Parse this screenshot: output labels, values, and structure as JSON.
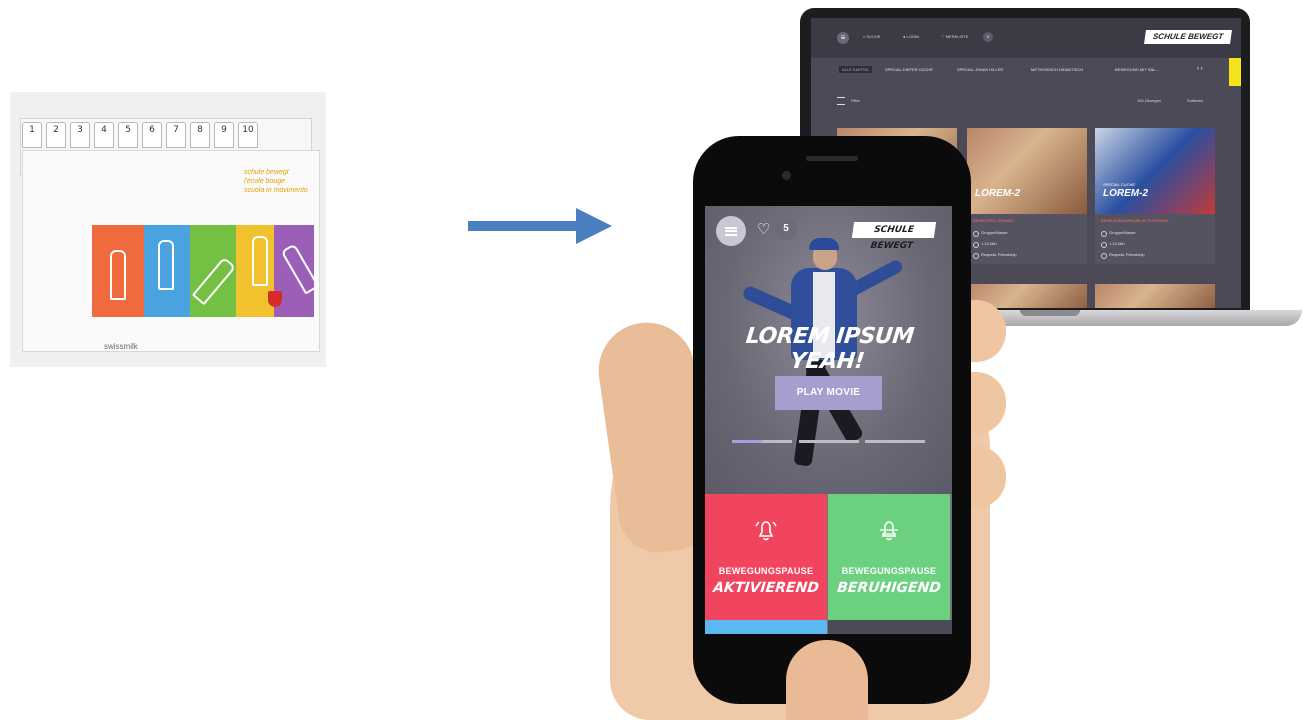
{
  "left_box": {
    "tab_numbers": [
      "1",
      "2",
      "3",
      "4",
      "5",
      "6",
      "7",
      "8",
      "9",
      "10"
    ],
    "side_text": [
      "schule bewegt",
      "l'école bouge",
      "scuola in movimento"
    ],
    "brand": "swissmilk",
    "stripe_colors": [
      "#ef6a3c",
      "#4aa3df",
      "#74c043",
      "#f2c12e",
      "#9b5fb8"
    ]
  },
  "arrow": {
    "color": "#4a7ebf"
  },
  "laptop": {
    "nav": {
      "search_label": "SUCHE",
      "login_label": "LOGIN",
      "watchlist_label": "MERKLISTE",
      "watchlist_count": "0",
      "logo": "SCHULE BEWEGT"
    },
    "tabs": [
      "ALLE KAPITEL",
      "SPECIAL DIEFER CUCHE",
      "SPECIAL JONAS HILLER",
      "METHODISCH DIDAKTISCH",
      "BEWEGUNG MIT SAL..."
    ],
    "filter_label": "Filter",
    "results_label": "100 Übungen",
    "sort_label": "Sortieren",
    "cards": [
      {
        "subtitle": "",
        "title": "LOREM-2",
        "tag": "BEWEGTES LERNEN",
        "lines": [
          "Gruppe/Klasse",
          "1-10 Min",
          "Respekt, Friendship"
        ]
      },
      {
        "subtitle": "SPECIAL CUCHE",
        "title": "LOREM-2",
        "tag": "BEWEGUNGSPAUSE AKTIVIEREND",
        "lines": [
          "Gruppe/Klasse",
          "1-10 Min",
          "Respekt, Friendship"
        ]
      }
    ]
  },
  "phone": {
    "fav_count": "5",
    "logo": "SCHULE BEWEGT",
    "hero_title": "LOREM IPSUM YEAH!",
    "play_label": "PLAY MOVIE",
    "slider_progress": 0.5,
    "tiles": [
      {
        "small": "BEWEGUNGSPAUSE",
        "big": "AKTIVIEREND",
        "color": "#f1455f",
        "icon": "bell-icon"
      },
      {
        "small": "BEWEGUNGSPAUSE",
        "big": "BERUHIGEND",
        "color": "#6cd17e",
        "icon": "calm-bell-icon"
      }
    ],
    "tile_row2_colors": [
      "#5bb8f0",
      "#4c4a57"
    ]
  }
}
